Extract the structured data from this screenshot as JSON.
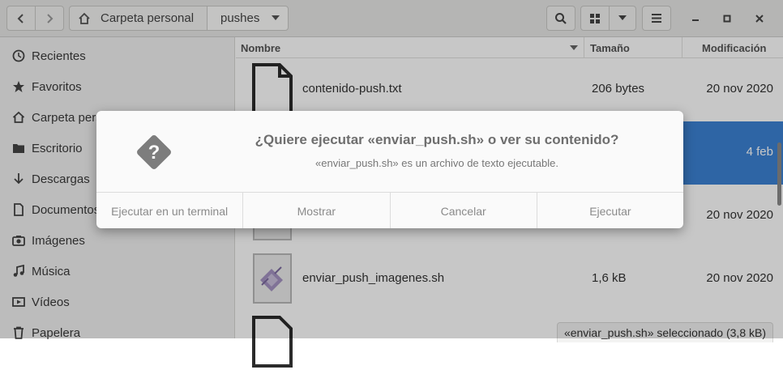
{
  "header": {
    "path": [
      "Carpeta personal",
      "pushes"
    ],
    "icons": [
      "go-back-icon",
      "go-forward-icon",
      "home-icon",
      "chevron-down-icon",
      "search-icon",
      "grid-view-icon",
      "chevron-down-icon",
      "hamburger-menu-icon",
      "minimize-icon",
      "maximize-icon",
      "close-icon"
    ]
  },
  "sidebar": {
    "items": [
      {
        "label": "Recientes",
        "icon": "clock-icon"
      },
      {
        "label": "Favoritos",
        "icon": "star-icon"
      },
      {
        "label": "Carpeta personal",
        "icon": "home-icon"
      },
      {
        "label": "Escritorio",
        "icon": "folder-icon"
      },
      {
        "label": "Descargas",
        "icon": "download-icon"
      },
      {
        "label": "Documentos",
        "icon": "document-icon"
      },
      {
        "label": "Imágenes",
        "icon": "camera-icon"
      },
      {
        "label": "Música",
        "icon": "music-icon"
      },
      {
        "label": "Vídeos",
        "icon": "video-icon"
      },
      {
        "label": "Papelera",
        "icon": "trash-icon"
      }
    ]
  },
  "list": {
    "columns": {
      "name": "Nombre",
      "size": "Tamaño",
      "modified": "Modificación"
    },
    "rows": [
      {
        "name": "contenido-push.txt",
        "size": "206 bytes",
        "modified": "20 nov 2020"
      },
      {
        "name": "",
        "size": "",
        "modified": "4 feb"
      },
      {
        "name": "",
        "size": "",
        "modified": "20 nov 2020"
      },
      {
        "name": "enviar_push_imagenes.sh",
        "size": "1,6 kB",
        "modified": "20 nov 2020"
      }
    ],
    "status": "«enviar_push.sh» seleccionado  (3,8 kB)"
  },
  "dialog": {
    "title": "¿Quiere ejecutar «enviar_push.sh» o ver su contenido?",
    "subtitle": "«enviar_push.sh» es un archivo de texto ejecutable.",
    "buttons": {
      "terminal": "Ejecutar en un terminal",
      "show": "Mostrar",
      "cancel": "Cancelar",
      "run": "Ejecutar"
    }
  },
  "colors": {
    "selection": "#3b82d4",
    "accent": "#3b82d4"
  }
}
